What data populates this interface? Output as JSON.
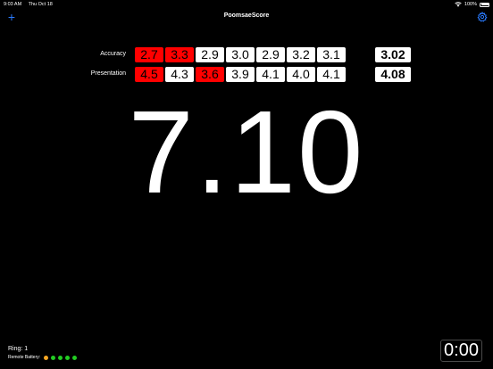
{
  "status_bar": {
    "time": "9:03 AM",
    "date": "Thu Oct 18",
    "battery": "100%"
  },
  "nav": {
    "title": "PoomsaeScore",
    "add_icon": "plus-icon",
    "settings_icon": "gear-icon",
    "add_symbol": "+"
  },
  "accuracy": {
    "label": "Accuracy",
    "scores": [
      {
        "value": "2.7",
        "dropped": true
      },
      {
        "value": "3.3",
        "dropped": true
      },
      {
        "value": "2.9",
        "dropped": false
      },
      {
        "value": "3.0",
        "dropped": false
      },
      {
        "value": "2.9",
        "dropped": false
      },
      {
        "value": "3.2",
        "dropped": false
      },
      {
        "value": "3.1",
        "dropped": false
      }
    ],
    "average": "3.02"
  },
  "presentation": {
    "label": "Presentation",
    "scores": [
      {
        "value": "4.5",
        "dropped": true
      },
      {
        "value": "4.3",
        "dropped": false
      },
      {
        "value": "3.6",
        "dropped": true
      },
      {
        "value": "3.9",
        "dropped": false
      },
      {
        "value": "4.1",
        "dropped": false
      },
      {
        "value": "4.0",
        "dropped": false
      },
      {
        "value": "4.1",
        "dropped": false
      }
    ],
    "average": "4.08"
  },
  "total": "7.10",
  "ring": {
    "label": "Ring:",
    "value": "1"
  },
  "remote_battery": {
    "label": "Remote Battery:",
    "dots": [
      "#f5a623",
      "#22cc22",
      "#22cc22",
      "#22cc22",
      "#22cc22"
    ]
  },
  "timer": "0:00",
  "colors": {
    "accent": "#2a7bff",
    "dropped": "#ff0000"
  }
}
